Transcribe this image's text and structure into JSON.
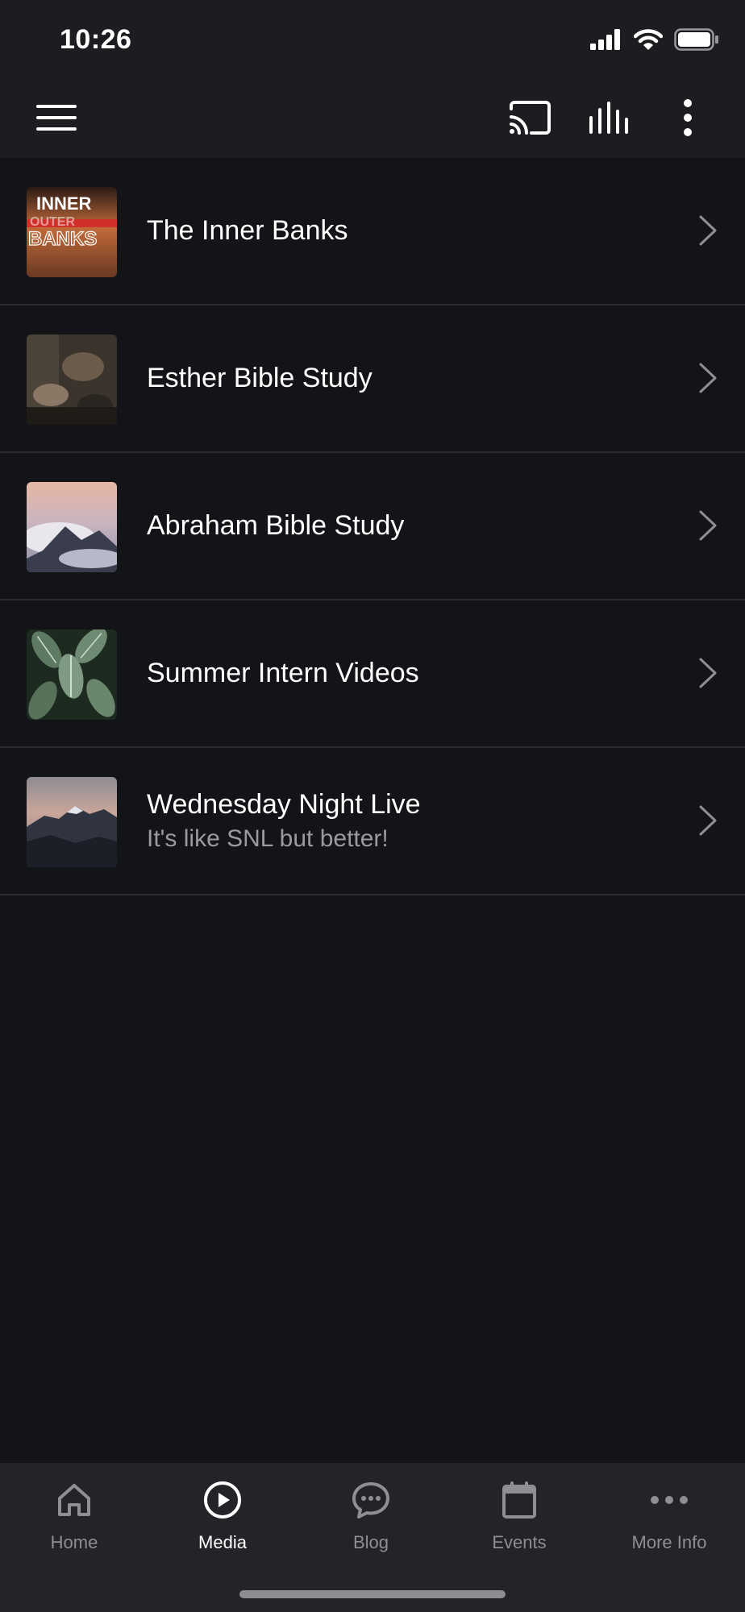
{
  "status_bar": {
    "time": "10:26"
  },
  "toolbar": {
    "icons": [
      "menu-icon",
      "cast-icon",
      "equalizer-icon",
      "more-vertical-icon"
    ]
  },
  "media_list": [
    {
      "title": "The Inner Banks",
      "subtitle": "",
      "thumb_text_top": "INNER",
      "thumb_text_mid": "OUTER",
      "thumb_text_bottom": "BANKS"
    },
    {
      "title": "Esther Bible Study",
      "subtitle": ""
    },
    {
      "title": "Abraham Bible Study",
      "subtitle": ""
    },
    {
      "title": "Summer Intern Videos",
      "subtitle": ""
    },
    {
      "title": "Wednesday Night Live",
      "subtitle": "It's like SNL but better!"
    }
  ],
  "tabbar": {
    "tabs": [
      {
        "label": "Home",
        "icon": "home-icon",
        "active": false
      },
      {
        "label": "Media",
        "icon": "play-circle-icon",
        "active": true
      },
      {
        "label": "Blog",
        "icon": "chat-bubble-icon",
        "active": false
      },
      {
        "label": "Events",
        "icon": "calendar-icon",
        "active": false
      },
      {
        "label": "More Info",
        "icon": "more-horizontal-icon",
        "active": false
      }
    ]
  },
  "colors": {
    "background": "#131417",
    "bar": "#1c1d20",
    "tabbar": "#232427",
    "divider": "#2a2b2f",
    "inactive": "#8e8f94"
  }
}
